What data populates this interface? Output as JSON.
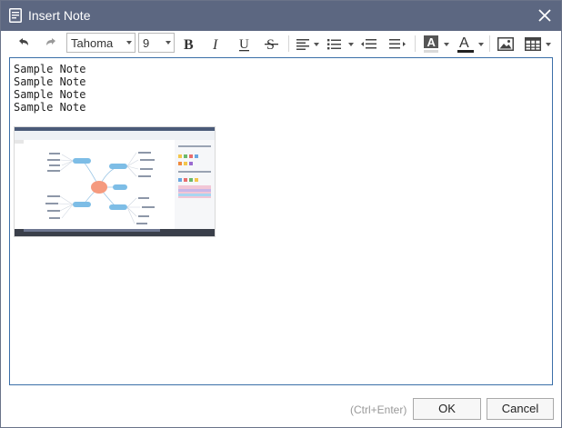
{
  "window": {
    "title": "Insert Note",
    "accent_color": "#5c6781"
  },
  "toolbar": {
    "font_family": "Tahoma",
    "font_size": "9"
  },
  "editor": {
    "lines": [
      "Sample Note",
      "Sample Note",
      "Sample Note",
      "Sample Note"
    ],
    "image": "mind-map screenshot thumbnail"
  },
  "footer": {
    "shortcut_hint": "(Ctrl+Enter)",
    "ok_label": "OK",
    "cancel_label": "Cancel"
  },
  "icons": [
    "note-icon",
    "close-icon",
    "undo-icon",
    "redo-icon",
    "bold-icon",
    "italic-icon",
    "underline-icon",
    "strikethrough-icon",
    "align-icon",
    "bullet-list-icon",
    "outdent-icon",
    "indent-icon",
    "highlight-color-icon",
    "font-color-icon",
    "insert-image-icon",
    "insert-table-icon"
  ]
}
